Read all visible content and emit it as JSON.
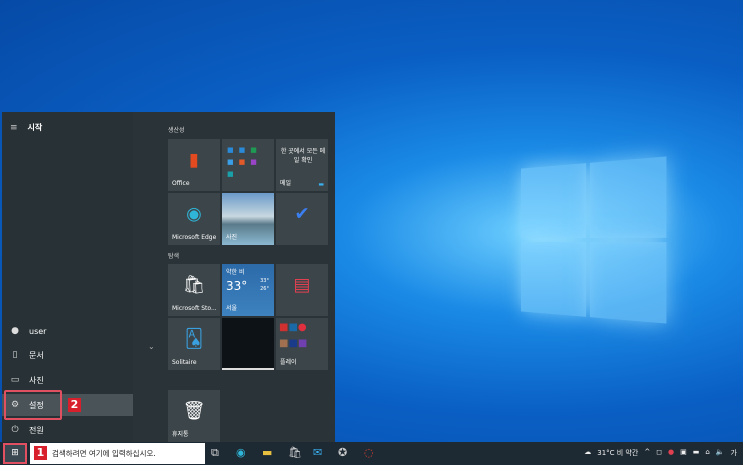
{
  "start_menu": {
    "title": "시작",
    "left_items": [
      {
        "label": "user",
        "icon": "user-avatar-icon"
      },
      {
        "label": "문서",
        "icon": "document-icon"
      },
      {
        "label": "사진",
        "icon": "pictures-icon"
      },
      {
        "label": "설정",
        "icon": "gear-icon"
      },
      {
        "label": "전원",
        "icon": "power-icon"
      }
    ],
    "groups": {
      "productivity": "생산성",
      "explore": "탐색"
    },
    "tiles": {
      "office": "Office",
      "mail_text": "한 곳에서 모든 메일 확인",
      "mail": "메일",
      "edge": "Microsoft Edge",
      "photos": "사진",
      "weather_cond": "약한 비",
      "weather_temp": "33°",
      "weather_hi": "33°",
      "weather_lo": "26°",
      "weather_city": "서울",
      "store": "Microsoft Sto...",
      "solitaire": "Solitaire",
      "play": "플레이",
      "recycle": "휴지통"
    }
  },
  "annotations": {
    "step1": "1",
    "step2": "2"
  },
  "taskbar": {
    "search_placeholder": "검색하려면 여기에 입력하십시오.",
    "weather": "31°C 비 약간",
    "ime": "가"
  }
}
